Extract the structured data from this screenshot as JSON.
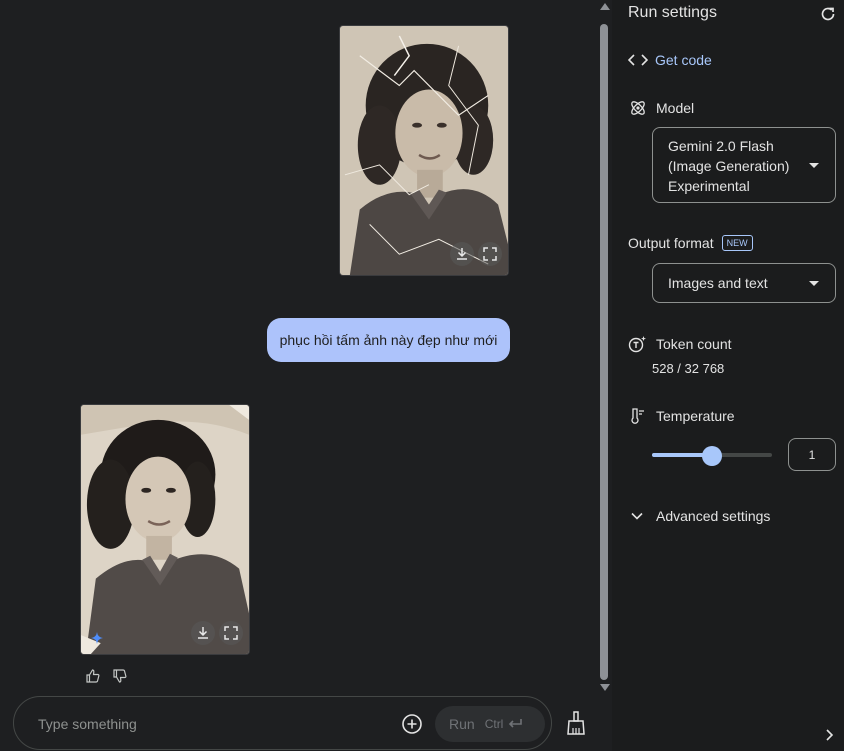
{
  "chat": {
    "user_message": "phục hồi tấm ảnh này đẹp như mới",
    "input_placeholder": "Type something",
    "run_label": "Run",
    "run_shortcut": "Ctrl"
  },
  "settings": {
    "title": "Run settings",
    "get_code": "Get code",
    "model_label": "Model",
    "model_value": "Gemini 2.0 Flash (Image Generation) Experimental",
    "output_format_label": "Output format",
    "output_format_badge": "NEW",
    "output_format_value": "Images and text",
    "token_count_label": "Token count",
    "token_count_value": "528 / 32 768",
    "temperature_label": "Temperature",
    "temperature_value": "1",
    "temperature_fraction": 0.5,
    "advanced_label": "Advanced settings"
  },
  "colors": {
    "accent": "#a8c7fa",
    "user_bubble": "#adc3fb",
    "background": "#1e1f21",
    "panel": "#1b1c1d"
  }
}
